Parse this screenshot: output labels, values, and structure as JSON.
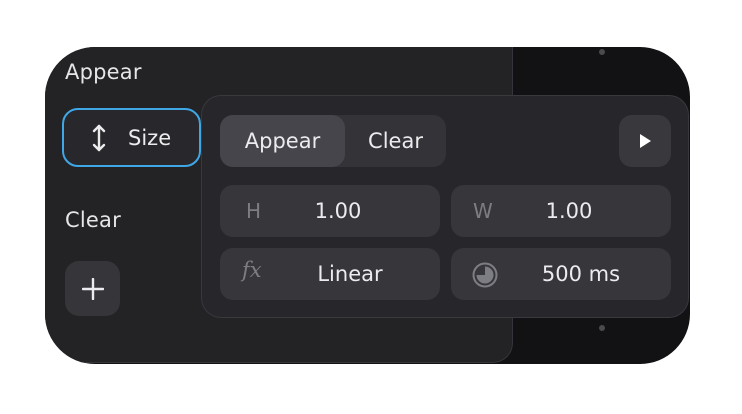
{
  "sections": {
    "appear_label": "Appear",
    "clear_label": "Clear",
    "appear_chip": {
      "icon": "vertical-resize-arrows-icon",
      "label": "Size"
    },
    "add_icon": "plus-icon"
  },
  "popover": {
    "tabs": [
      {
        "label": "Appear",
        "active": true
      },
      {
        "label": "Clear",
        "active": false
      }
    ],
    "play_icon": "play-icon",
    "fields": {
      "height": {
        "label": "H",
        "value": "1.00"
      },
      "width": {
        "label": "W",
        "value": "1.00"
      },
      "easing": {
        "icon": "fx-icon",
        "value": "Linear"
      },
      "duration": {
        "icon": "timer-icon",
        "value": "500 ms"
      }
    }
  },
  "colors": {
    "accent": "#3fa7e6",
    "panel": "#232326",
    "popover": "#27272b",
    "field": "#36363b",
    "text": "#ececee",
    "muted": "#7d7d84"
  }
}
